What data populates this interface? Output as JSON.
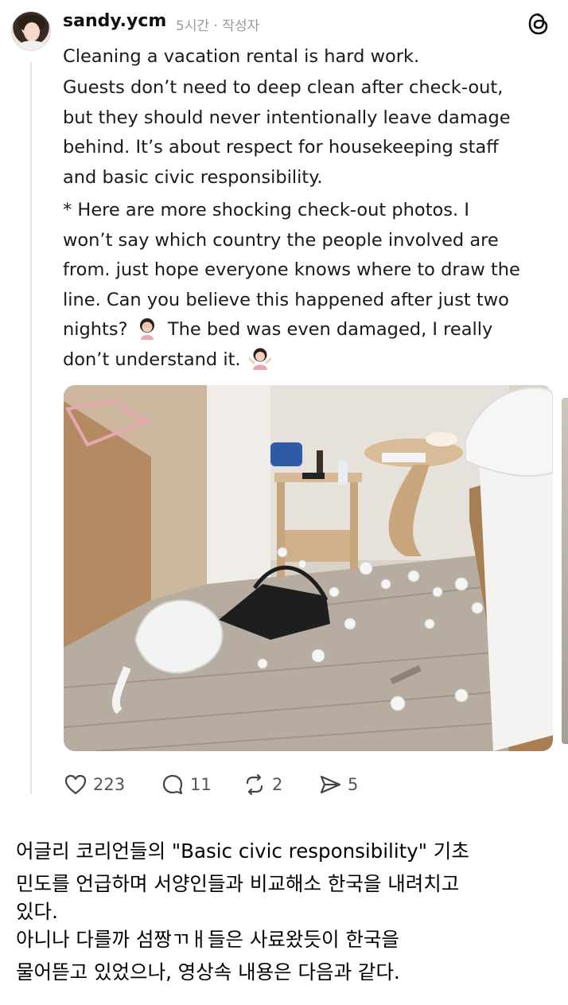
{
  "post": {
    "username": "sandy.ycm",
    "meta": "5시간 · 작성자",
    "paragraph1": "Cleaning a vacation rental is hard work.",
    "paragraph2_lines": [
      "Guests don’t need to deep clean after check-out,",
      "but they should never intentionally leave damage",
      "behind. It’s about respect for housekeeping staff",
      "and basic civic responsibility."
    ],
    "paragraph3_lines": [
      "* Here are more shocking check-out photos. I",
      "won’t say which country the people involved are",
      "from. just hope everyone knows where to draw the",
      "line. Can you believe this happened after just two"
    ],
    "paragraph3_line5_before": "nights?",
    "paragraph3_line5_after": "The bed was even damaged, I really",
    "paragraph3_line6": "don’t understand it.",
    "emoji_1": "woman-facepalming-emoji",
    "emoji_2": "woman-shrugging-emoji"
  },
  "actions": {
    "likes": "223",
    "comments": "11",
    "reposts": "2",
    "shares": "5"
  },
  "caption_lines": [
    "어글리 코리언들의 \"Basic civic responsibility\" 기초",
    "민도를 언급하며 서양인들과 비교해소 한국을 내려치고",
    "있다.",
    "아니나 다를까 섬짱ㄲㅐ들은 사료왔듯이 한국을",
    "물어뜯고 있었으나, 영상속 내용은 다음과 같다."
  ],
  "colors": {
    "text": "#1a1a1a",
    "meta": "#9a9a9a",
    "icon": "#444444",
    "thread_line": "#e4e4e4"
  }
}
